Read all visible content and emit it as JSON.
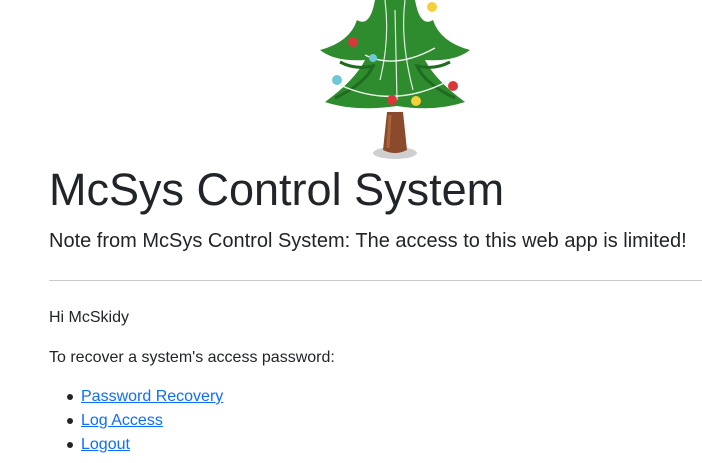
{
  "header": {
    "title": "McSys Control System",
    "note": "Note from McSys Control System: The access to this web app is limited!"
  },
  "main": {
    "greeting": "Hi McSkidy",
    "instruction": "To recover a system's access password:",
    "links": [
      {
        "label": "Password Recovery"
      },
      {
        "label": "Log Access"
      },
      {
        "label": "Logout"
      }
    ]
  },
  "colors": {
    "text": "#212529",
    "link": "#0d6efd",
    "divider": "#c9c9c9",
    "tree_green": "#2e8b2e",
    "trunk": "#8b4a2b"
  },
  "images": {
    "logo": "christmas-tree"
  }
}
